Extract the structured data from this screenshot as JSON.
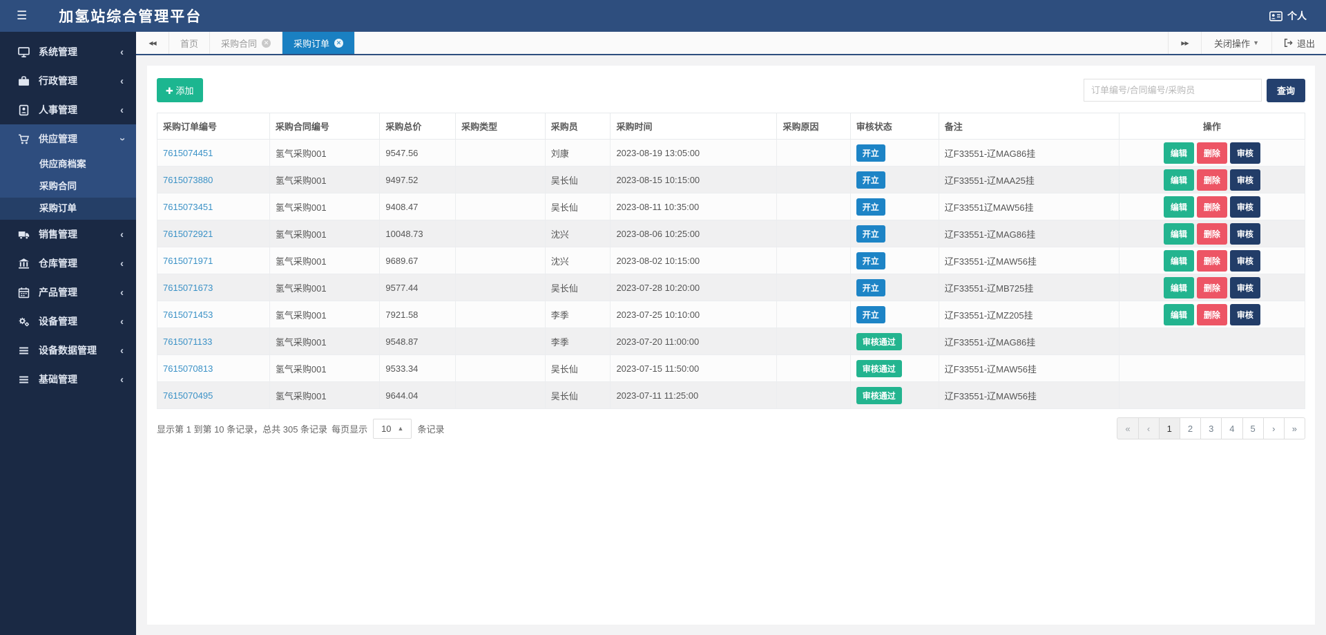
{
  "app": {
    "title": "加氢站综合管理平台",
    "user_label": "个人"
  },
  "colors": {
    "header": "#2e4e7e",
    "sidebar": "#1a2944",
    "sidebar_expanded": "#2e4d7e",
    "active_tab": "#1a80c2",
    "green": "#23b48f",
    "add_green": "#1cb690",
    "red": "#ed5565",
    "navy": "#223d68",
    "link": "#3a91c6",
    "badge_open": "#1d84c6",
    "badge_passed": "#23b48f"
  },
  "sidebar": {
    "groups": [
      {
        "key": "system",
        "label": "系统管理",
        "icon": "monitor-icon",
        "expanded": false
      },
      {
        "key": "administrative",
        "label": "行政管理",
        "icon": "briefcase-icon",
        "expanded": false
      },
      {
        "key": "personnel",
        "label": "人事管理",
        "icon": "id-badge-icon",
        "expanded": false
      },
      {
        "key": "supply",
        "label": "供应管理",
        "icon": "cart-icon",
        "expanded": true,
        "children": [
          {
            "key": "supplier-archive",
            "label": "供应商档案",
            "active": false
          },
          {
            "key": "purchase-contract",
            "label": "采购合同",
            "active": false
          },
          {
            "key": "purchase-order",
            "label": "采购订单",
            "active": true
          }
        ]
      },
      {
        "key": "sales",
        "label": "销售管理",
        "icon": "truck-icon",
        "expanded": false
      },
      {
        "key": "warehouse",
        "label": "仓库管理",
        "icon": "bank-icon",
        "expanded": false
      },
      {
        "key": "product",
        "label": "产品管理",
        "icon": "calendar-icon",
        "expanded": false
      },
      {
        "key": "equipment",
        "label": "设备管理",
        "icon": "gears-icon",
        "expanded": false
      },
      {
        "key": "equipment-data",
        "label": "设备数据管理",
        "icon": "list-icon",
        "expanded": false
      },
      {
        "key": "basic",
        "label": "基础管理",
        "icon": "list-icon",
        "expanded": false
      }
    ]
  },
  "tabbar": {
    "tabs": [
      {
        "key": "home",
        "label": "首页",
        "closable": false,
        "active": false
      },
      {
        "key": "purchase-contract",
        "label": "采购合同",
        "closable": true,
        "active": false
      },
      {
        "key": "purchase-order",
        "label": "采购订单",
        "closable": true,
        "active": true
      }
    ],
    "close_ops_label": "关闭操作",
    "logout_label": "退出"
  },
  "toolbar": {
    "add_label": "添加",
    "search_placeholder": "订单编号/合同编号/采购员",
    "search_button_label": "查询"
  },
  "table": {
    "columns": [
      {
        "key": "order_no",
        "label": "采购订单编号",
        "width": "9.8%"
      },
      {
        "key": "contract_no",
        "label": "采购合同编号",
        "width": "9.6%"
      },
      {
        "key": "total_price",
        "label": "采购总价",
        "width": "6.6%"
      },
      {
        "key": "purchase_type",
        "label": "采购类型",
        "width": "7.8%"
      },
      {
        "key": "buyer",
        "label": "采购员",
        "width": "5.7%"
      },
      {
        "key": "purchase_time",
        "label": "采购时间",
        "width": "14.5%"
      },
      {
        "key": "reason",
        "label": "采购原因",
        "width": "6.4%"
      },
      {
        "key": "audit_status",
        "label": "审核状态",
        "width": "7.7%"
      },
      {
        "key": "remark",
        "label": "备注",
        "width": "15.7%"
      },
      {
        "key": "actions",
        "label": "操作",
        "width": "16.2%"
      }
    ],
    "action_labels": {
      "edit": "编辑",
      "delete": "删除",
      "audit": "审核"
    },
    "rows": [
      {
        "order_no": "7615074451",
        "contract_no": "氢气采购001",
        "total_price": "9547.56",
        "purchase_type": "",
        "buyer": "刘康",
        "purchase_time": "2023-08-19 13:05:00",
        "reason": "",
        "audit_status": "开立",
        "remark": "辽F33551-辽MAG86挂",
        "has_actions": true
      },
      {
        "order_no": "7615073880",
        "contract_no": "氢气采购001",
        "total_price": "9497.52",
        "purchase_type": "",
        "buyer": "吴长仙",
        "purchase_time": "2023-08-15 10:15:00",
        "reason": "",
        "audit_status": "开立",
        "remark": "辽F33551-辽MAA25挂",
        "has_actions": true
      },
      {
        "order_no": "7615073451",
        "contract_no": "氢气采购001",
        "total_price": "9408.47",
        "purchase_type": "",
        "buyer": "吴长仙",
        "purchase_time": "2023-08-11 10:35:00",
        "reason": "",
        "audit_status": "开立",
        "remark": "辽F33551辽MAW56挂",
        "has_actions": true
      },
      {
        "order_no": "7615072921",
        "contract_no": "氢气采购001",
        "total_price": "10048.73",
        "purchase_type": "",
        "buyer": "沈兴",
        "purchase_time": "2023-08-06 10:25:00",
        "reason": "",
        "audit_status": "开立",
        "remark": "辽F33551-辽MAG86挂",
        "has_actions": true
      },
      {
        "order_no": "7615071971",
        "contract_no": "氢气采购001",
        "total_price": "9689.67",
        "purchase_type": "",
        "buyer": "沈兴",
        "purchase_time": "2023-08-02 10:15:00",
        "reason": "",
        "audit_status": "开立",
        "remark": "辽F33551-辽MAW56挂",
        "has_actions": true
      },
      {
        "order_no": "7615071673",
        "contract_no": "氢气采购001",
        "total_price": "9577.44",
        "purchase_type": "",
        "buyer": "吴长仙",
        "purchase_time": "2023-07-28 10:20:00",
        "reason": "",
        "audit_status": "开立",
        "remark": "辽F33551-辽MB725挂",
        "has_actions": true
      },
      {
        "order_no": "7615071453",
        "contract_no": "氢气采购001",
        "total_price": "7921.58",
        "purchase_type": "",
        "buyer": "李季",
        "purchase_time": "2023-07-25 10:10:00",
        "reason": "",
        "audit_status": "开立",
        "remark": "辽F33551-辽MZ205挂",
        "has_actions": true
      },
      {
        "order_no": "7615071133",
        "contract_no": "氢气采购001",
        "total_price": "9548.87",
        "purchase_type": "",
        "buyer": "李季",
        "purchase_time": "2023-07-20 11:00:00",
        "reason": "",
        "audit_status": "审核通过",
        "remark": "辽F33551-辽MAG86挂",
        "has_actions": false
      },
      {
        "order_no": "7615070813",
        "contract_no": "氢气采购001",
        "total_price": "9533.34",
        "purchase_type": "",
        "buyer": "吴长仙",
        "purchase_time": "2023-07-15 11:50:00",
        "reason": "",
        "audit_status": "审核通过",
        "remark": "辽F33551-辽MAW56挂",
        "has_actions": false
      },
      {
        "order_no": "7615070495",
        "contract_no": "氢气采购001",
        "total_price": "9644.04",
        "purchase_type": "",
        "buyer": "吴长仙",
        "purchase_time": "2023-07-11 11:25:00",
        "reason": "",
        "audit_status": "审核通过",
        "remark": "辽F33551-辽MAW56挂",
        "has_actions": false
      }
    ],
    "status_styles": {
      "开立": "badge-open",
      "审核通过": "badge-passed"
    }
  },
  "footer": {
    "summary": "显示第 1 到第 10 条记录，总共 305 条记录",
    "page_size_prefix": "每页显示",
    "page_size": "10",
    "page_size_suffix": "条记录",
    "pagination": {
      "items": [
        "«",
        "‹",
        "1",
        "2",
        "3",
        "4",
        "5",
        "›",
        "»"
      ],
      "active": "1",
      "disabled": [
        "«",
        "‹"
      ]
    }
  }
}
